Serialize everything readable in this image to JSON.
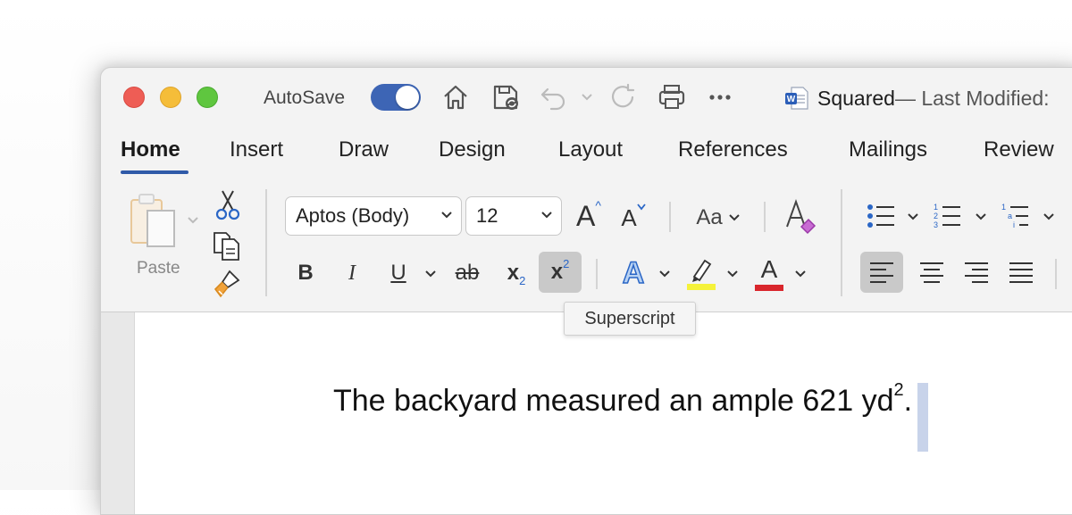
{
  "titlebar": {
    "autosave_label": "AutoSave",
    "autosave_on": true,
    "doc_name": "Squared",
    "modified_text": " — Last Modified:"
  },
  "icons": {
    "home": "home-icon",
    "save": "save-icon",
    "undo": "undo-icon",
    "redo": "redo-icon",
    "print": "print-icon",
    "more": "more-icon",
    "word": "word-doc-icon"
  },
  "tabs": [
    "Home",
    "Insert",
    "Draw",
    "Design",
    "Layout",
    "References",
    "Mailings",
    "Review"
  ],
  "active_tab": "Home",
  "clipboard": {
    "paste_label": "Paste"
  },
  "font": {
    "family": "Aptos (Body)",
    "size": "12",
    "change_case_label": "Aa",
    "bold": "B",
    "italic": "I",
    "underline": "U",
    "strike": "ab",
    "subscript": "x",
    "subscript_index": "2",
    "superscript": "x",
    "superscript_index": "2",
    "grow_label": "A",
    "shrink_label": "A",
    "effects_label": "A",
    "font_color_label": "A"
  },
  "colors": {
    "accent": "#2f5aa8",
    "highlight": "#f5f23a",
    "font_color": "#d9262c",
    "selection": "#c8d3ea"
  },
  "tooltip": "Superscript",
  "document": {
    "text": "The backyard measured an ample 621 yd",
    "superscript": "2",
    "trailing": "."
  }
}
